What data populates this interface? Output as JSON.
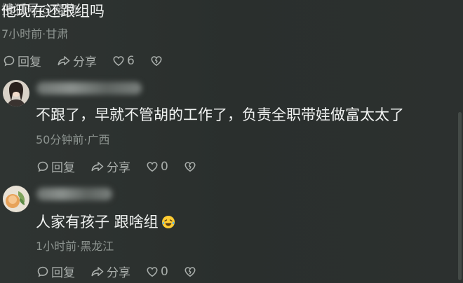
{
  "top_comment": {
    "text": "他现在还跟组吗",
    "meta": "7小时前·甘肃",
    "reply_label": "回复",
    "share_label": "分享",
    "like_count": "6"
  },
  "watermark": "搜狐号@宠物",
  "replies": [
    {
      "text": "不跟了，早就不管胡的工作了，负责全职带娃做富太太了",
      "meta": "50分钟前·广西",
      "reply_label": "回复",
      "share_label": "分享",
      "like_count": "0"
    },
    {
      "text": "人家有孩子 跟啥组",
      "meta": "1小时前·黑龙江",
      "reply_label": "回复",
      "share_label": "分享",
      "like_count": "0"
    }
  ],
  "icons": {
    "reply": "reply-bubble-icon",
    "share": "share-arrow-icon",
    "like": "heart-icon",
    "dislike": "broken-heart-icon",
    "emoji": "laughing-tears-emoji-icon"
  },
  "colors": {
    "background": "#2b302e",
    "text_primary": "#f1f3f2",
    "text_meta": "#8e9591",
    "action": "#a9aeab"
  }
}
